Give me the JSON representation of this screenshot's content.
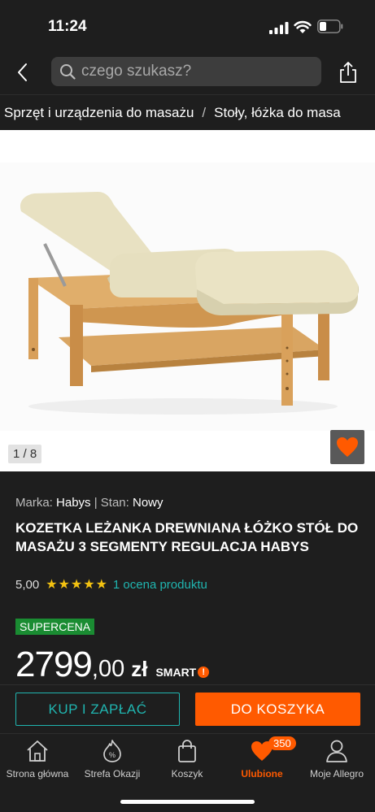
{
  "status_bar": {
    "time": "11:24"
  },
  "search": {
    "placeholder": "czego szukasz?"
  },
  "breadcrumb": [
    "Sprzęt i urządzenia do masażu",
    "Stoły, łóżka do masa"
  ],
  "gallery": {
    "counter": "1 / 8"
  },
  "product": {
    "brand_label": "Marka:",
    "brand": "Habys",
    "separator": "|",
    "condition_label": "Stan:",
    "condition": "Nowy",
    "title": "KOZETKA LEŻANKA DREWNIANA ŁÓŻKO STÓŁ DO MASAŻU 3 SEGMENTY REGULACJA HABYS",
    "rating_value": "5,00",
    "stars": "★★★★★",
    "rating_link": "1 ocena produktu",
    "badge": "SUPERCENA",
    "price_int": "2799",
    "price_dec": ",00",
    "currency": "zł",
    "smart_label": "SMART"
  },
  "actions": {
    "buy_now": "KUP I ZAPŁAĆ",
    "add_to_cart": "DO KOSZYKA"
  },
  "nav": {
    "items": [
      {
        "label": "Strona główna",
        "icon": "home-icon"
      },
      {
        "label": "Strefa Okazji",
        "icon": "deals-icon"
      },
      {
        "label": "Koszyk",
        "icon": "cart-icon"
      },
      {
        "label": "Ulubione",
        "icon": "heart-icon",
        "badge": "350"
      },
      {
        "label": "Moje Allegro",
        "icon": "user-icon"
      }
    ]
  },
  "colors": {
    "accent_orange": "#ff5a00",
    "accent_teal": "#20b5b0",
    "badge_green": "#1a8c32",
    "star_yellow": "#f3c211",
    "background": "#1e1e1e"
  }
}
